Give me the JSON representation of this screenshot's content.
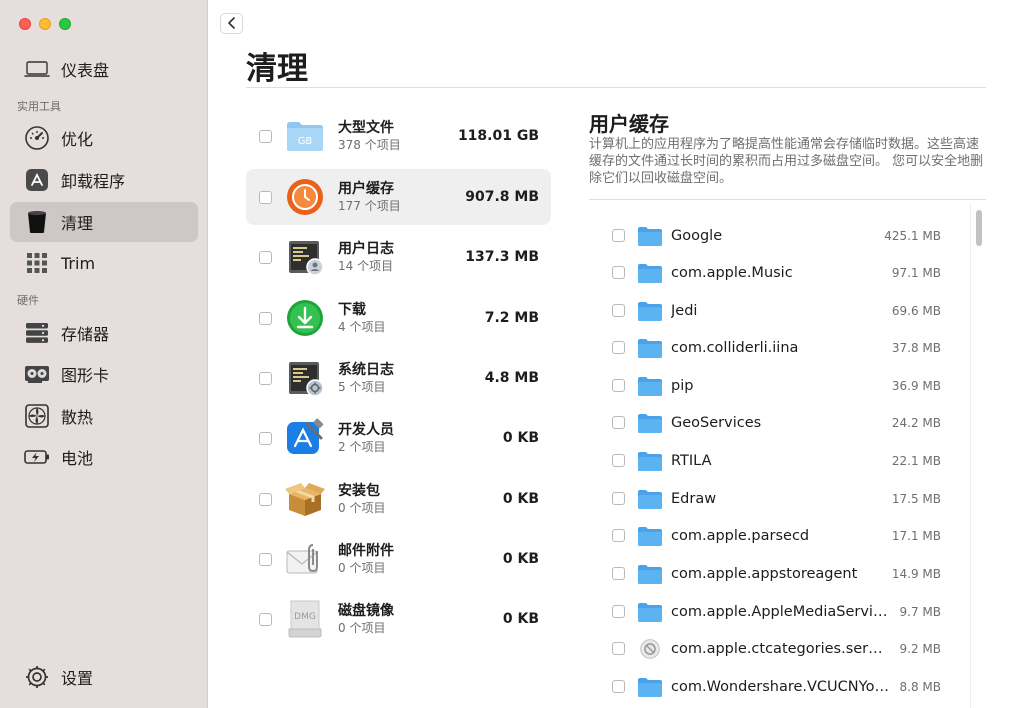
{
  "sidebar": {
    "dashboard": "仪表盘",
    "section_tools": "实用工具",
    "optimize": "优化",
    "uninstall": "卸载程序",
    "clean": "清理",
    "trim": "Trim",
    "section_hardware": "硬件",
    "storage": "存储器",
    "graphics": "图形卡",
    "cooling": "散热",
    "battery": "电池",
    "settings": "设置"
  },
  "main": {
    "title": "清理",
    "categories": [
      {
        "name": "大型文件",
        "count": "378 个项目",
        "size": "118.01 GB",
        "icon": "large-files-icon"
      },
      {
        "name": "用户缓存",
        "count": "177 个项目",
        "size": "907.8 MB",
        "icon": "user-cache-icon"
      },
      {
        "name": "用户日志",
        "count": "14 个项目",
        "size": "137.3 MB",
        "icon": "user-logs-icon"
      },
      {
        "name": "下载",
        "count": "4 个项目",
        "size": "7.2 MB",
        "icon": "downloads-icon"
      },
      {
        "name": "系统日志",
        "count": "5 个项目",
        "size": "4.8 MB",
        "icon": "system-logs-icon"
      },
      {
        "name": "开发人员",
        "count": "2 个项目",
        "size": "0 KB",
        "icon": "developer-icon"
      },
      {
        "name": "安装包",
        "count": "0 个项目",
        "size": "0 KB",
        "icon": "installer-package-icon"
      },
      {
        "name": "邮件附件",
        "count": "0 个项目",
        "size": "0 KB",
        "icon": "mail-attachment-icon"
      },
      {
        "name": "磁盘镜像",
        "count": "0 个项目",
        "size": "0 KB",
        "icon": "disk-image-icon"
      }
    ],
    "large_files_badge": "GB",
    "disk_image_badge": "DMG"
  },
  "detail": {
    "title": "用户缓存",
    "description": "计算机上的应用程序为了略提高性能通常会存储临时数据。这些高速缓存的文件通过长时间的累积而占用过多磁盘空间。 您可以安全地删除它们以回收磁盘空间。",
    "files": [
      {
        "name": "Google",
        "size": "425.1 MB"
      },
      {
        "name": "com.apple.Music",
        "size": "97.1 MB"
      },
      {
        "name": "Jedi",
        "size": "69.6 MB"
      },
      {
        "name": "com.colliderli.iina",
        "size": "37.8 MB"
      },
      {
        "name": "pip",
        "size": "36.9 MB"
      },
      {
        "name": "GeoServices",
        "size": "24.2 MB"
      },
      {
        "name": "RTILA",
        "size": "22.1 MB"
      },
      {
        "name": "Edraw",
        "size": "17.5 MB"
      },
      {
        "name": "com.apple.parsecd",
        "size": "17.1 MB"
      },
      {
        "name": "com.apple.appstoreagent",
        "size": "14.9 MB"
      },
      {
        "name": "com.apple.AppleMediaServices",
        "size": "9.7 MB"
      },
      {
        "name": "com.apple.ctcategories.service",
        "size": "9.2 MB"
      },
      {
        "name": "com.Wondershare.VCUCNYou...",
        "size": "8.8 MB"
      }
    ]
  },
  "colors": {
    "sidebar_bg": "#e6dedd",
    "sidebar_active": "#cfc7c6",
    "folder_blue": "#5aaef0",
    "selected_row": "#efefef"
  }
}
